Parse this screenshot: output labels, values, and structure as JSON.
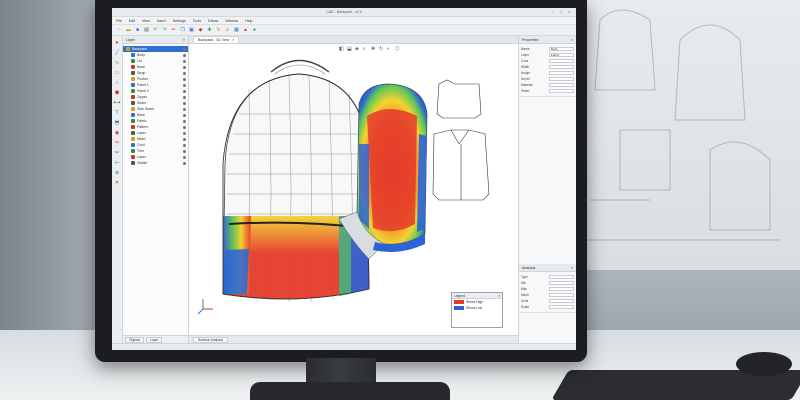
{
  "app": {
    "title": "CAD - Backpack - v2.0",
    "window_controls": [
      "–",
      "□",
      "×"
    ]
  },
  "menubar": [
    "File",
    "Edit",
    "View",
    "Insert",
    "Settings",
    "Tools",
    "Extras",
    "Window",
    "Help"
  ],
  "toolbar": {
    "icons": [
      "new-icon",
      "open-icon",
      "save-icon",
      "print-icon",
      "undo-icon",
      "redo-icon",
      "cut-icon",
      "copy-icon",
      "paste-icon",
      "select-icon",
      "move-icon",
      "rotate-icon",
      "zoom-icon",
      "grid-icon",
      "layers-icon",
      "render-icon"
    ],
    "accent": "#2f6fd0"
  },
  "layer_panel": {
    "title": "Layer",
    "items": [
      "Backpack",
      "Body",
      "Lid",
      "Base",
      "Strap",
      "Pocket",
      "Panel 1",
      "Panel 2",
      "Zipper",
      "Seam",
      "Side Seam",
      "Back",
      "Fabric",
      "Pattern",
      "Layer",
      "Mesh",
      "Cord",
      "Trim",
      "Layer",
      "Visible"
    ],
    "selected_index": 0,
    "footer_tabs": [
      "Objects",
      "Layer"
    ]
  },
  "canvas": {
    "doc_tab": "Backpack - 3D View",
    "bottom_tab": "Surface Analysis"
  },
  "legend": {
    "title": "Legend",
    "rows": [
      {
        "label": "Stress High",
        "color": "#e53b2b"
      },
      {
        "label": "Stress Low",
        "color": "#2c64d8"
      }
    ]
  },
  "properties": {
    "title": "Properties",
    "rows": [
      {
        "k": "Name",
        "v": "Body"
      },
      {
        "k": "Layer",
        "v": "Fabric"
      },
      {
        "k": "Color",
        "v": ""
      },
      {
        "k": "Width",
        "v": ""
      },
      {
        "k": "Height",
        "v": ""
      },
      {
        "k": "Depth",
        "v": ""
      },
      {
        "k": "Material",
        "v": ""
      },
      {
        "k": "Seam",
        "v": ""
      }
    ],
    "analysis_title": "Analysis",
    "analysis_rows": [
      {
        "k": "Type",
        "v": ""
      },
      {
        "k": "Min",
        "v": ""
      },
      {
        "k": "Max",
        "v": ""
      },
      {
        "k": "Mesh",
        "v": ""
      },
      {
        "k": "Units",
        "v": ""
      },
      {
        "k": "Scale",
        "v": ""
      }
    ]
  },
  "colors": {
    "heat_red": "#e53b2b",
    "heat_yellow": "#f3d331",
    "heat_green": "#5cc65a",
    "heat_blue": "#2c64d8",
    "selection": "#2f6fd0"
  }
}
